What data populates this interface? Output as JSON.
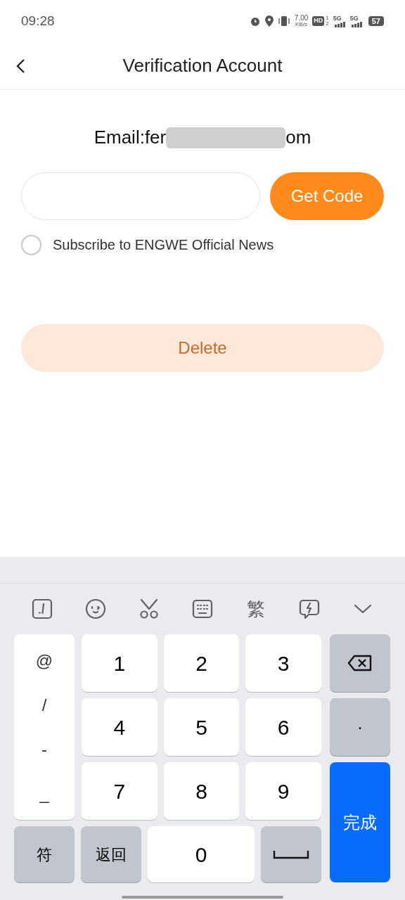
{
  "status_bar": {
    "time": "09:28",
    "net_speed": [
      "7.00",
      "KB/s"
    ],
    "hd": "HD",
    "sims": [
      "1",
      "2"
    ],
    "signals": [
      "5G",
      "5G"
    ],
    "battery": "57"
  },
  "header": {
    "title": "Verification Account"
  },
  "email": {
    "label": "Email:fer",
    "suffix": "om",
    "redacted": true
  },
  "get_code_button": {
    "label": "Get Code"
  },
  "subscribe": {
    "label": "Subscribe to ENGWE Official News",
    "checked": false
  },
  "delete_button": {
    "label": "Delete",
    "disabled": true
  },
  "keyboard": {
    "toolbar": [
      {
        "kind": "icon"
      },
      {
        "kind": "icon"
      },
      {
        "kind": "icon"
      },
      {
        "kind": "icon"
      },
      {
        "kind": "text",
        "label": "繁"
      },
      {
        "kind": "icon"
      },
      {
        "kind": "icon"
      }
    ],
    "symbols": [
      "@",
      "/",
      "-",
      "_"
    ],
    "digits": [
      "1",
      "2",
      "3",
      "4",
      "5",
      "6",
      "7",
      "8",
      "9"
    ],
    "dot": "·",
    "done": "完成",
    "bottom": [
      {
        "kind": "text",
        "label": "符"
      },
      {
        "kind": "text",
        "label": "返回"
      },
      {
        "kind": "digit",
        "label": "0"
      },
      {
        "kind": "space"
      }
    ]
  }
}
